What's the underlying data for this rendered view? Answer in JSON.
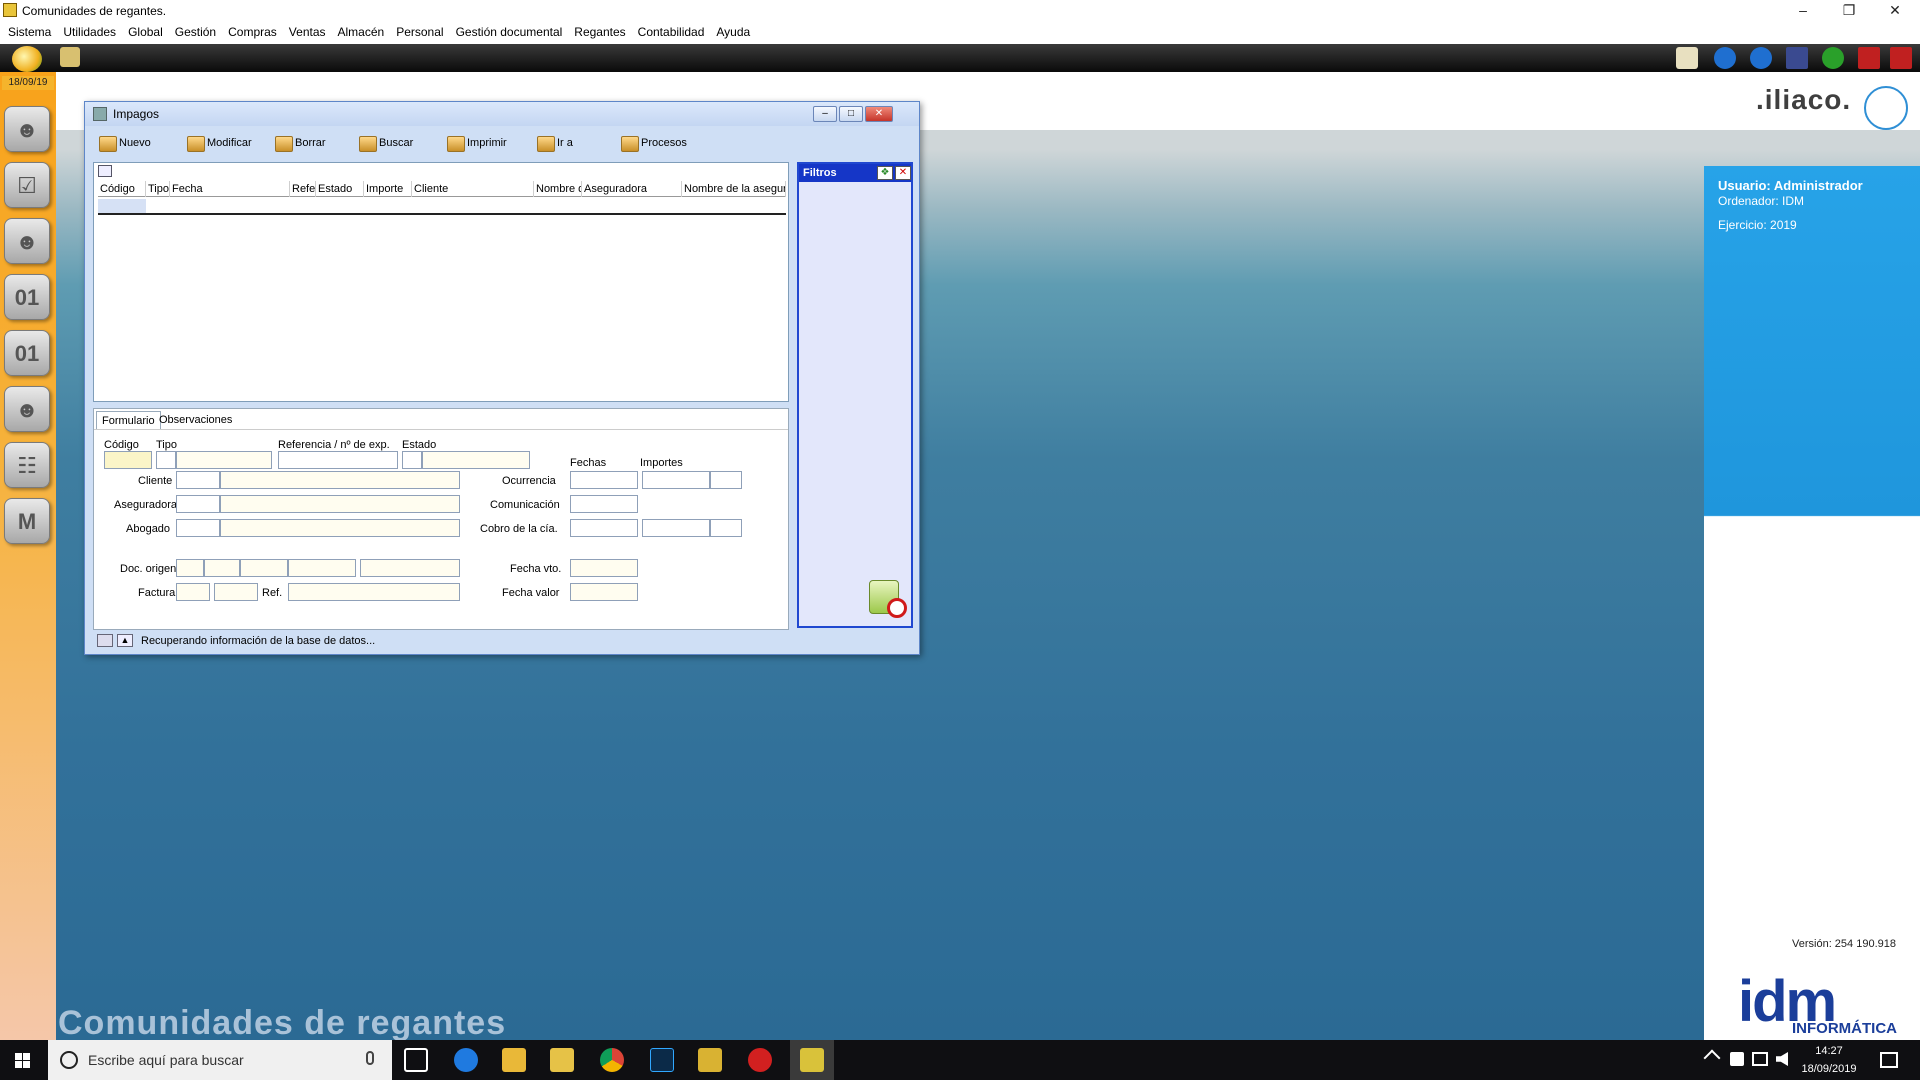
{
  "titlebar": {
    "title": "Comunidades de regantes."
  },
  "menu": [
    "Sistema",
    "Utilidades",
    "Global",
    "Gestión",
    "Compras",
    "Ventas",
    "Almacén",
    "Personal",
    "Gestión documental",
    "Regantes",
    "Contabilidad",
    "Ayuda"
  ],
  "sidebar": {
    "date": "18/09/19"
  },
  "window": {
    "title": "Impagos",
    "tools": [
      "Nuevo",
      "Modificar",
      "Borrar",
      "Buscar",
      "Imprimir",
      "Ir a",
      "Procesos"
    ],
    "columns": [
      "Código",
      "Tipo",
      "Fecha",
      "Refe",
      "Estado",
      "Importe",
      "Cliente",
      "Nombre d",
      "Aseguradora",
      "Nombre de la asegur"
    ],
    "filters_title": "Filtros",
    "tabs": [
      "Formulario",
      "Observaciones"
    ],
    "form": {
      "codigo": "Código",
      "tipo": "Tipo",
      "referencia": "Referencia / nº de exp.",
      "estado": "Estado",
      "cliente": "Cliente",
      "aseguradora": "Aseguradora",
      "abogado": "Abogado",
      "doc_origen": "Doc. origen",
      "factura": "Factura",
      "ref": "Ref.",
      "fechas": "Fechas",
      "importes": "Importes",
      "ocurrencia": "Ocurrencia",
      "comunicacion": "Comunicación",
      "cobro": "Cobro de la cía.",
      "fecha_vto": "Fecha vto.",
      "fecha_valor": "Fecha valor"
    },
    "status": "Recuperando información de la base de datos..."
  },
  "desktop": {
    "brand": ".iliaco.",
    "user": "Usuario: Administrador",
    "computer": "Ordenador: IDM",
    "year": "Ejercicio: 2019",
    "version": "Versión: 254 190.918",
    "idm": "idm",
    "idm_sub": "INFORMÁTICA",
    "caption": "Comunidades de regantes"
  },
  "taskbar": {
    "search_placeholder": "Escribe aquí para buscar",
    "time": "14:27",
    "date": "18/09/2019"
  },
  "colors": {
    "accent": "#1536c7",
    "sidebar": "#f8a21a",
    "desktop": "#2b6a94"
  }
}
